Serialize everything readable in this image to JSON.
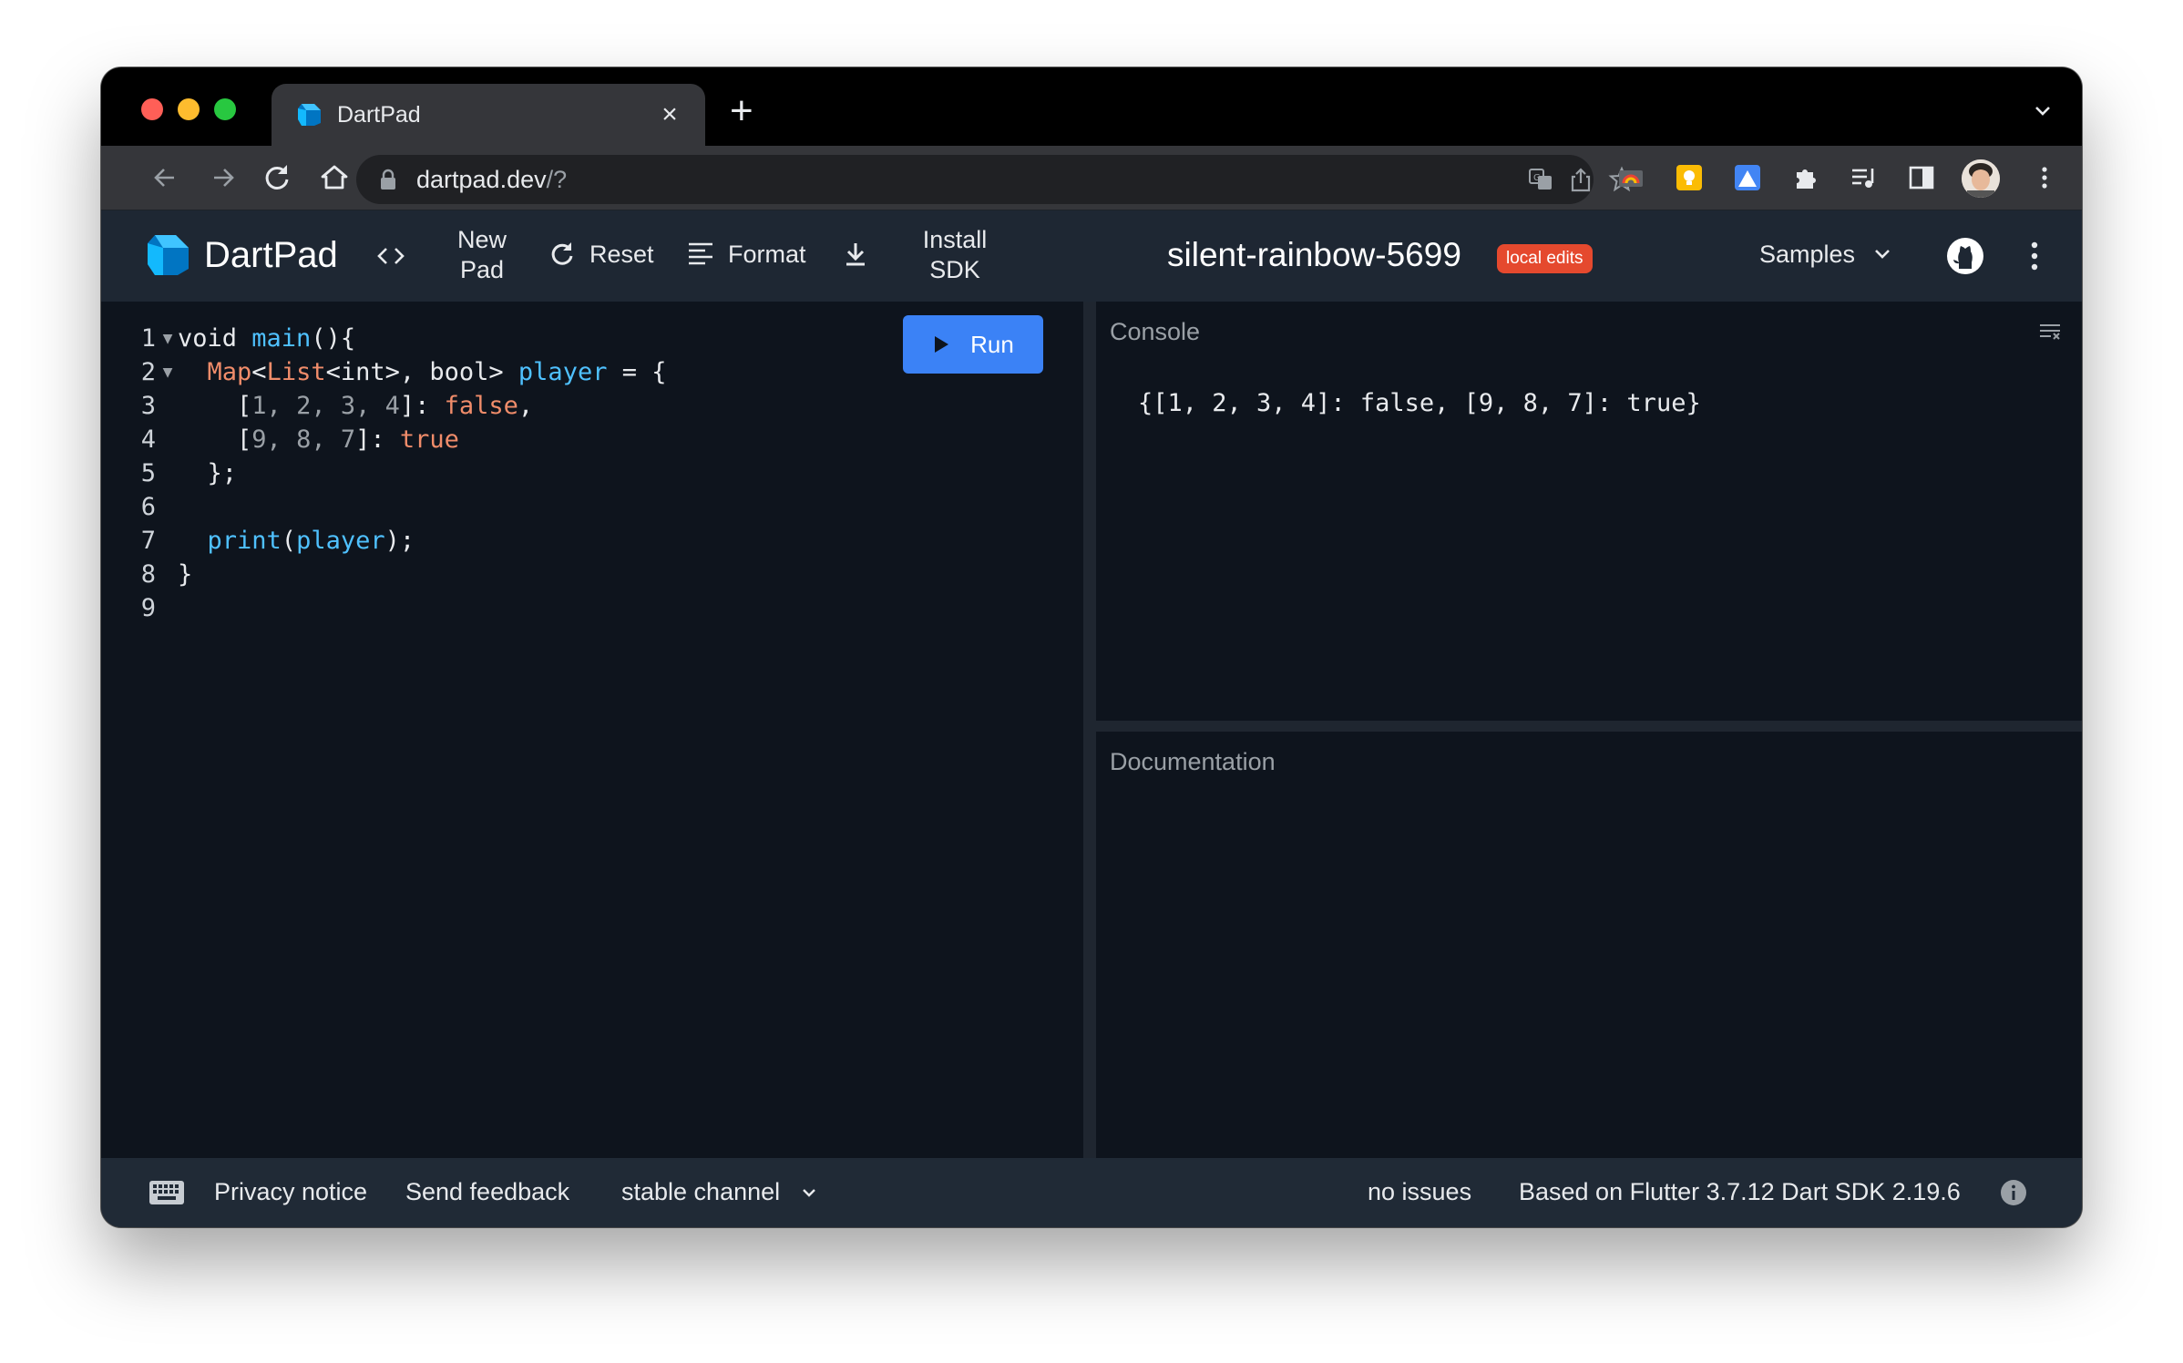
{
  "browser": {
    "tab": {
      "title": "DartPad",
      "close_glyph": "×",
      "favicon": "dart-logo-icon"
    },
    "new_tab_glyph": "+",
    "url": {
      "host": "dartpad.dev",
      "path": "/?"
    },
    "icons": [
      "back-icon",
      "forward-icon",
      "reload-icon",
      "home-icon",
      "lock-icon",
      "translate-icon",
      "share-icon",
      "star-icon",
      "extension-icon",
      "puzzle-icon",
      "media-icon",
      "sidebar-icon",
      "profile-avatar",
      "kebab-menu-icon"
    ]
  },
  "appbar": {
    "logo_text": "DartPad",
    "new_pad": {
      "line1": "New",
      "line2": "Pad"
    },
    "reset_label": "Reset",
    "format_label": "Format",
    "install": {
      "line1": "Install",
      "line2": "SDK"
    },
    "pad_name": "silent-rainbow-5699",
    "badge": "local edits",
    "samples_label": "Samples"
  },
  "editor": {
    "run_label": "Run",
    "lines": [
      {
        "n": "1",
        "fold": "▼"
      },
      {
        "n": "2",
        "fold": "▼"
      },
      {
        "n": "3",
        "fold": ""
      },
      {
        "n": "4",
        "fold": ""
      },
      {
        "n": "5",
        "fold": ""
      },
      {
        "n": "6",
        "fold": ""
      },
      {
        "n": "7",
        "fold": ""
      },
      {
        "n": "8",
        "fold": ""
      },
      {
        "n": "9",
        "fold": ""
      }
    ],
    "code": {
      "l1_void": "void ",
      "l1_main": "main",
      "l1_rest": "(){",
      "l2_map": "Map",
      "l2_lt": "<",
      "l2_list": "List",
      "l2_types": "<int>, bool> ",
      "l2_player": "player",
      "l2_rest": " = {",
      "l3_open": "[",
      "l3_nums": "1, 2, 3, 4",
      "l3_close": "]: ",
      "l3_val": "false",
      "l3_comma": ",",
      "l4_open": "[",
      "l4_nums": "9, 8, 7",
      "l4_close": "]: ",
      "l4_val": "true",
      "l5": "};",
      "l7_print": "print",
      "l7_open": "(",
      "l7_arg": "player",
      "l7_close": ");",
      "l8": "}"
    }
  },
  "console": {
    "title": "Console",
    "output": "{[1, 2, 3, 4]: false, [9, 8, 7]: true}"
  },
  "docs": {
    "title": "Documentation"
  },
  "footer": {
    "privacy": "Privacy notice",
    "feedback": "Send feedback",
    "channel": "stable channel",
    "issues": "no issues",
    "version": "Based on Flutter 3.7.12 Dart SDK 2.19.6"
  },
  "colors": {
    "run_button": "#3b82f6",
    "badge": "#e5492e",
    "editor_bg": "#0e141d",
    "appbar_bg": "#1e2733"
  }
}
